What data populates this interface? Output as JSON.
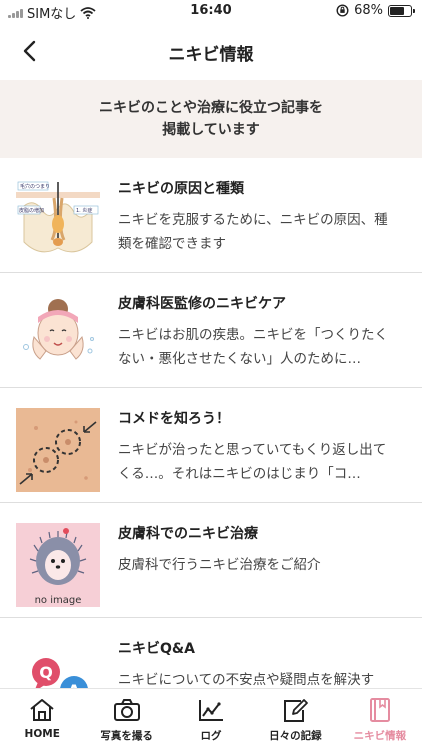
{
  "status_bar": {
    "carrier": "SIMなし",
    "time": "16:40",
    "battery_percent": "68%",
    "battery_level": 0.68
  },
  "nav": {
    "title": "ニキビ情報"
  },
  "banner": {
    "line1": "ニキビのことや治療に役立つ記事を",
    "line2": "掲載しています"
  },
  "articles": [
    {
      "title": "ニキビの原因と種類",
      "description": "ニキビを克服するために、ニキビの原因、種類を確認できます",
      "thumb_labels": [
        "毛穴のつまり",
        "皮脂の増加",
        "1. 炎症"
      ]
    },
    {
      "title": "皮膚科医監修のニキビケア",
      "description": "ニキビはお肌の疾患。ニキビを「つくりたくない・悪化させたくない」人のために…"
    },
    {
      "title": "コメドを知ろう！",
      "description": "ニキビが治ったと思っていてもくり返し出てくる…。それはニキビのはじまり「コ…"
    },
    {
      "title": "皮膚科でのニキビ治療",
      "description": "皮膚科で行うニキビ治療をご紹介",
      "thumb_caption": "no image"
    },
    {
      "title": "ニキビQ&A",
      "description": "ニキビについての不安点や疑問点を解決す",
      "thumb_letters": [
        "Q",
        "A"
      ]
    }
  ],
  "tabs": [
    {
      "label": "HOME",
      "icon": "home-icon"
    },
    {
      "label": "写真を撮る",
      "icon": "camera-icon"
    },
    {
      "label": "ログ",
      "icon": "chart-icon"
    },
    {
      "label": "日々の記録",
      "icon": "edit-icon"
    },
    {
      "label": "ニキビ情報",
      "icon": "book-icon",
      "active": true
    }
  ],
  "colors": {
    "accent": "#e58ca0",
    "banner_bg": "#f6f1ee",
    "divider": "#dedede"
  }
}
